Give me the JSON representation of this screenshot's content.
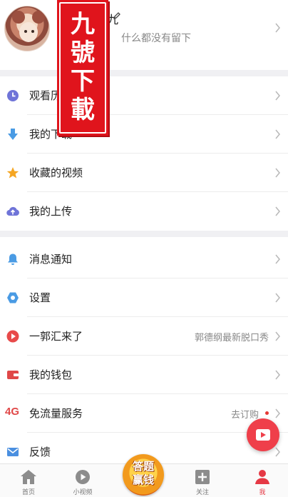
{
  "profile": {
    "username": "九",
    "bio": "什么都没有留下"
  },
  "watermark": {
    "text": "九號下載"
  },
  "menu_group_1": [
    {
      "label": "观看历史",
      "icon": "clock-icon",
      "color": "#6f74d8"
    },
    {
      "label": "我的下载",
      "icon": "download-arrow-icon",
      "color": "#4a9be4"
    },
    {
      "label": "收藏的视频",
      "icon": "star-icon",
      "color": "#f5a623"
    },
    {
      "label": "我的上传",
      "icon": "cloud-upload-icon",
      "color": "#6f74d8"
    }
  ],
  "menu_group_2": [
    {
      "label": "消息通知",
      "icon": "bell-icon",
      "color": "#4a9be4",
      "value": ""
    },
    {
      "label": "设置",
      "icon": "hexagon-settings-icon",
      "color": "#4a9be4",
      "value": ""
    },
    {
      "label": "一郭汇来了",
      "icon": "play-circle-icon",
      "color": "#e84a4a",
      "value": "郭德纲最新脱口秀"
    },
    {
      "label": "我的钱包",
      "icon": "wallet-icon",
      "color": "#e04848",
      "value": ""
    },
    {
      "label": "免流量服务",
      "icon": "4g-icon",
      "icon_text": "4G",
      "color": "#e04848",
      "value": "去订购"
    },
    {
      "label": "反馈",
      "icon": "mail-icon",
      "color": "#4a8fe0",
      "value": ""
    }
  ],
  "tabbar": {
    "tabs": [
      {
        "label": "首页",
        "icon": "home-icon",
        "active": false
      },
      {
        "label": "小视频",
        "icon": "play-circle-icon",
        "active": false
      },
      {
        "label": "关注",
        "icon": "plus-square-icon",
        "active": false
      },
      {
        "label": "我",
        "icon": "person-icon",
        "active": true
      }
    ],
    "center_badge": "答题赢钱"
  },
  "colors": {
    "accent": "#e53945",
    "icon_gray": "#8c8c8c",
    "divider": "#ececec",
    "background_gap": "#f0f0f3"
  }
}
